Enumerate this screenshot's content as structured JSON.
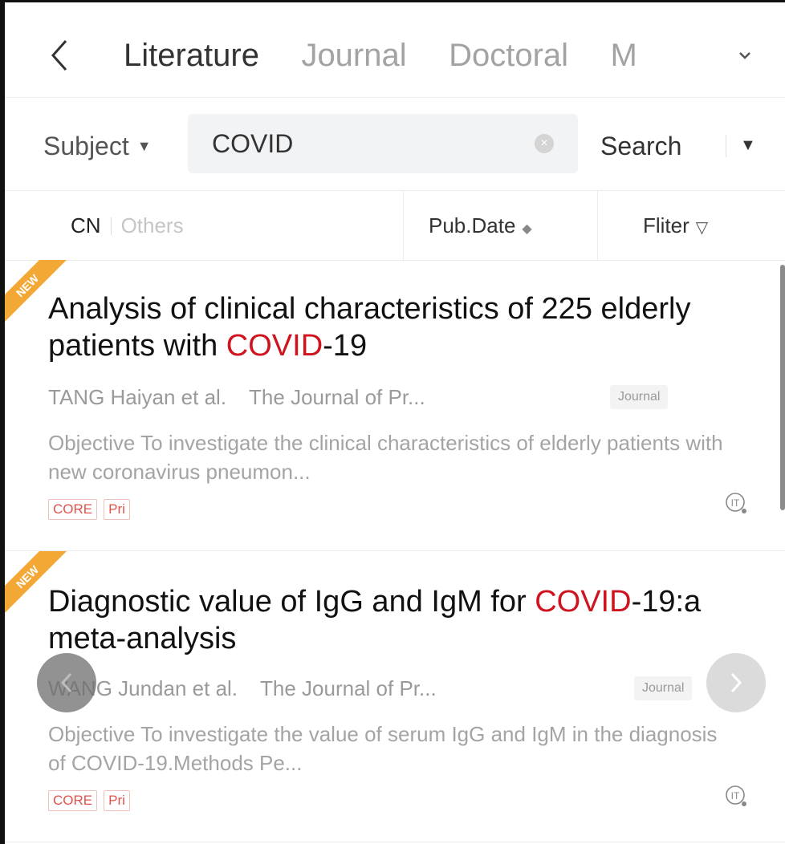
{
  "tabs": [
    {
      "label": "Literature",
      "active": true
    },
    {
      "label": "Journal",
      "active": false
    },
    {
      "label": "Doctoral",
      "active": false
    },
    {
      "label": "M",
      "active": false
    }
  ],
  "icons": {
    "back": "chevron-left-icon",
    "more_tabs": "chevron-down-icon",
    "clear": "clear-icon",
    "search_dropdown": "caret-down-icon",
    "sort": "sort-icon",
    "filter": "funnel-icon",
    "cite": "cite-icon",
    "prev": "chevron-left-icon",
    "next": "chevron-right-icon"
  },
  "search": {
    "field_label": "Subject",
    "value": "COVID",
    "button_label": "Search"
  },
  "filters": {
    "lang_cn": "CN",
    "lang_others": "Others",
    "pub_date": "Pub.Date",
    "filter_label": "Fliter"
  },
  "colors": {
    "highlight": "#d0141f",
    "new_ribbon": "#f3a735",
    "tag": "#e0524b"
  },
  "results": [
    {
      "badge": "NEW",
      "title_pre": "Analysis of clinical characteristics of 225 elderly patients with ",
      "title_hl": "COVID",
      "title_post": "-19",
      "authors": "TANG Haiyan et al.",
      "journal": "The Journal of Pr...",
      "type": "Journal",
      "abstract": "Objective To investigate the clinical characteristics of elderly patients with new coronavirus pneumon...",
      "tags": [
        "CORE",
        "Pri"
      ]
    },
    {
      "badge": "NEW",
      "title_pre": "Diagnostic value of IgG and IgM for ",
      "title_hl": "COVID",
      "title_post": "-19:a meta-analysis",
      "authors": "WANG Jundan et al.",
      "journal": "The Journal of Pr...",
      "type": "Journal",
      "abstract": "Objective To investigate the value of serum IgG and IgM in the diagnosis of COVID-19.Methods Pe...",
      "tags": [
        "CORE",
        "Pri"
      ]
    }
  ]
}
